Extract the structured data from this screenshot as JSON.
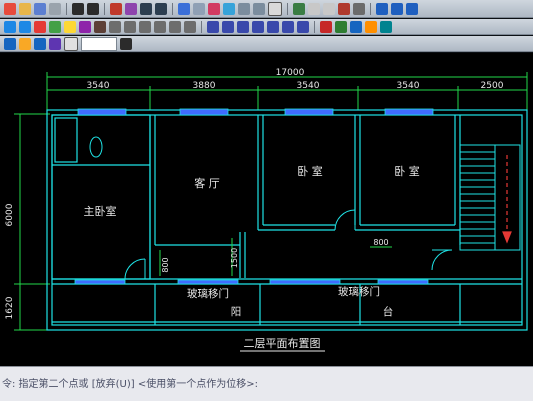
{
  "toolbars": {
    "row1": [
      "new-icon",
      "open-icon",
      "save-icon",
      "print-icon",
      "cut-icon",
      "copy-icon",
      "paste-icon",
      "undo-icon",
      "redo-icon",
      "pan-icon",
      "zoom-icon",
      "zoom-window-icon",
      "zoom-prev-icon",
      "properties-icon",
      "design-center-icon",
      "tool-palette-icon",
      "sheet-set-icon",
      "markup-icon",
      "calc-icon",
      "help-icon"
    ],
    "row3_dropdown": ""
  },
  "drawing": {
    "title": "二层平面布置图",
    "overall_dim": "17000",
    "top_dims": [
      "3540",
      "3880",
      "3540",
      "3540",
      "2500"
    ],
    "left_dims": [
      "6000",
      "1620"
    ],
    "rooms": {
      "master_bedroom": "主卧室",
      "living_room": "客  厅",
      "bedroom1": "卧  室",
      "bedroom2": "卧  室"
    },
    "door_dims": [
      "800",
      "1500",
      "800"
    ],
    "sliding_door_1": "玻璃移门",
    "sliding_door_2": "玻璃移门",
    "balcony_1": "阳",
    "balcony_2": "台"
  },
  "command_line": {
    "text": "令:  指定第二个点或  [放弃(U)]  <使用第一个点作为位移>:"
  },
  "colors": {
    "wall": "#1fe3e6",
    "dim": "#22d84a",
    "text": "#e8e8e8",
    "window": "#3f6cff"
  }
}
